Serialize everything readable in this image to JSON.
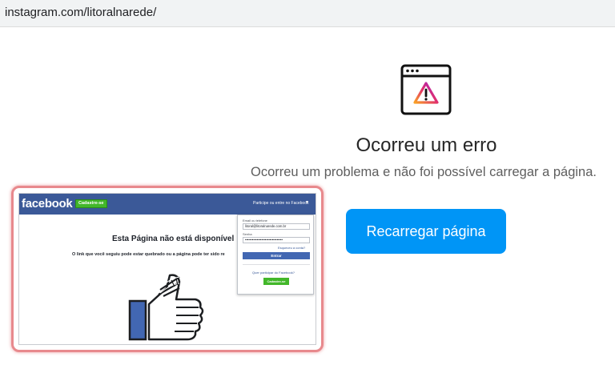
{
  "browser": {
    "url": "instagram.com/litoralnarede/"
  },
  "instagram_error": {
    "icon": "error-window-icon",
    "title": "Ocorreu um erro",
    "description": "Ocorreu um problema e não foi possível carregar a página.",
    "reload_label": "Recarregar página",
    "accent": "#0095f6"
  },
  "facebook": {
    "logo": "facebook",
    "signup_top_label": "Cadastre-se",
    "join_text": "Participe ou entre no Facebook",
    "page_title": "Esta Página não está disponível",
    "page_subtitle": "O link que você seguiu pode estar quebrado ou a página pode ter sido re",
    "login": {
      "email_label": "Email ou telefone",
      "email_value": "litoral@litoralnarede.com.br",
      "password_label": "Senha",
      "password_value": "••••••••••••••••••••••••••••••••",
      "forgot_label": "Esqueceu a conta?",
      "enter_label": "Entrar",
      "question": "Quer participar do Facebook?",
      "signup_label": "Cadastre-se"
    },
    "brand_color": "#3b5998",
    "thumb_icon": "bandaged-thumbs-up-icon"
  }
}
